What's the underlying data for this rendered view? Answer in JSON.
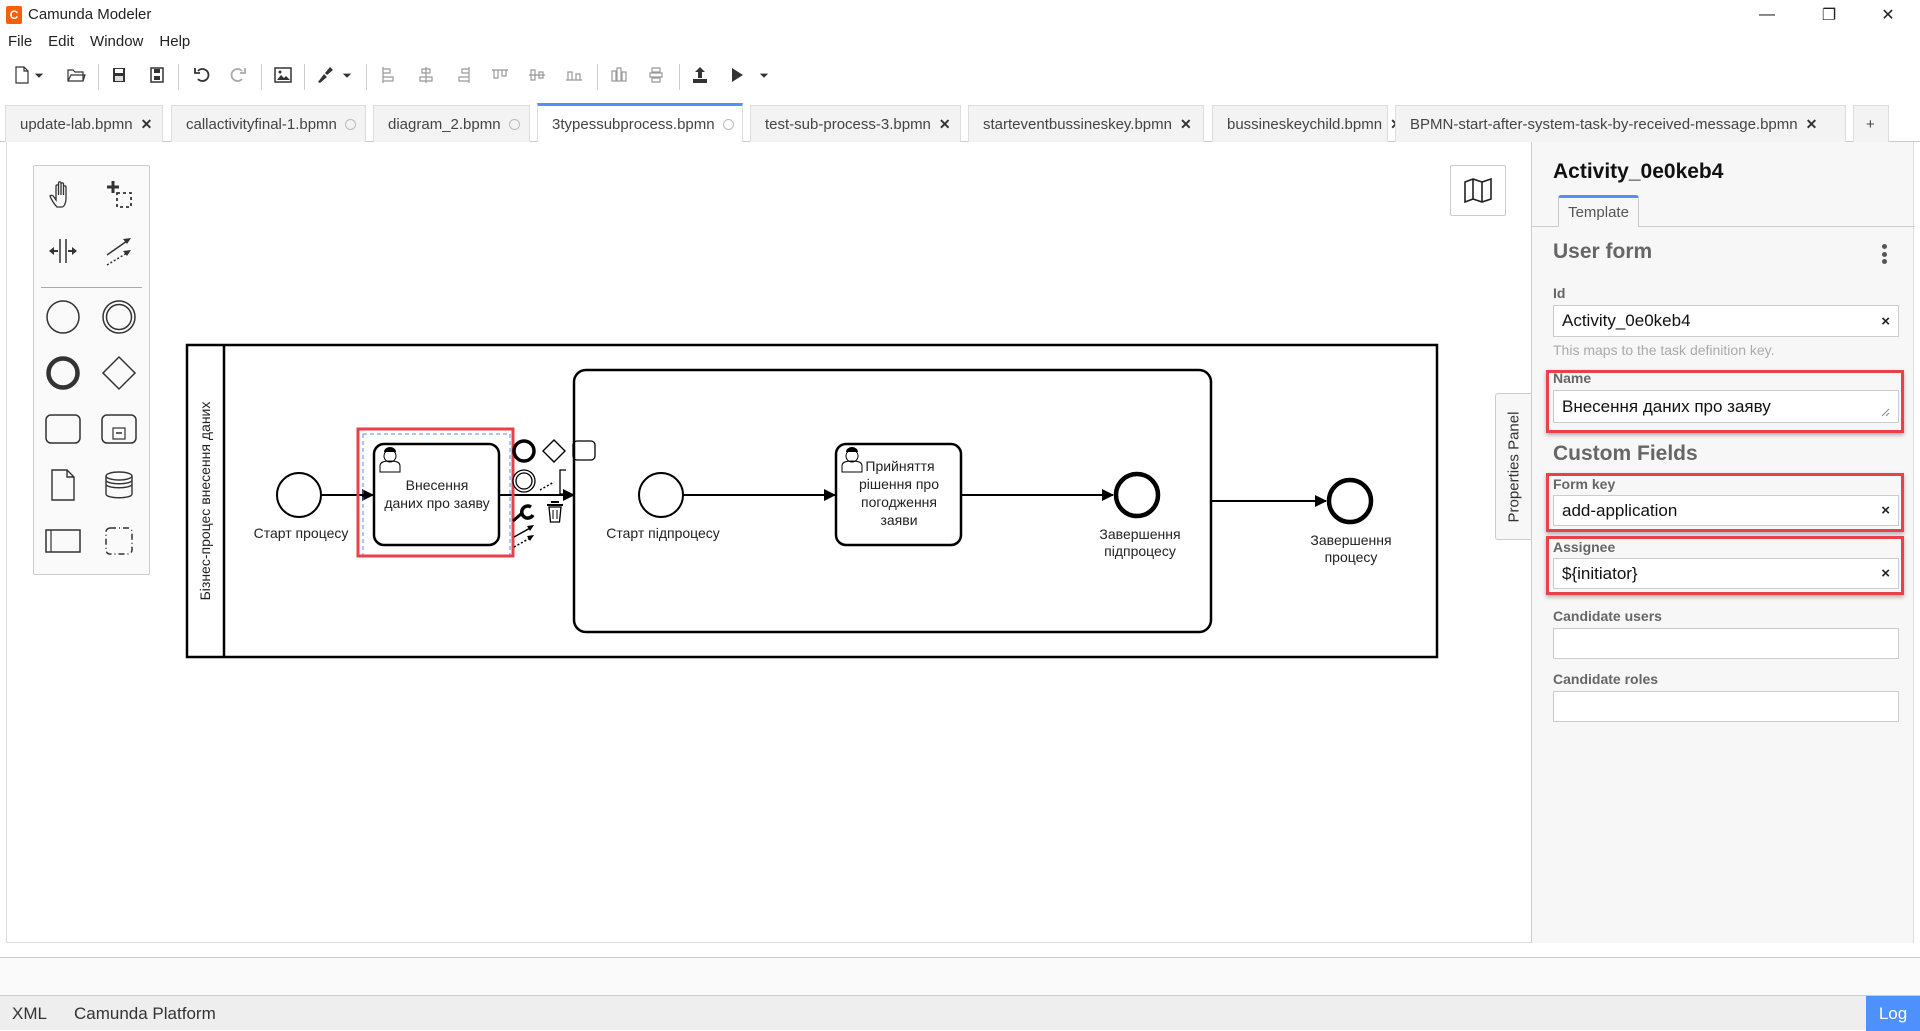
{
  "window": {
    "title": "Camunda Modeler",
    "logo_glyph": "C",
    "controls": {
      "minimize": "—",
      "maximize": "❐",
      "close": "✕"
    }
  },
  "menu": [
    "File",
    "Edit",
    "Window",
    "Help"
  ],
  "toolbar": {
    "icons": [
      "new-file-icon",
      "open-file-icon",
      "save-icon",
      "save-as-icon",
      "undo-icon",
      "redo-icon",
      "export-image-icon",
      "color-brush-icon",
      "align-left-icon",
      "align-center-icon",
      "align-right-icon",
      "align-top-icon",
      "align-middle-icon",
      "align-bottom-icon",
      "distribute-horizontal-icon",
      "distribute-vertical-icon",
      "deploy-icon",
      "run-icon"
    ]
  },
  "tabs": [
    {
      "label": "update-lab.bpmn",
      "state": "close"
    },
    {
      "label": "callactivityfinal-1.bpmn",
      "state": "unsaved"
    },
    {
      "label": "diagram_2.bpmn",
      "state": "unsaved"
    },
    {
      "label": "3typessubprocess.bpmn",
      "state": "unsaved",
      "active": true
    },
    {
      "label": "test-sub-process-3.bpmn",
      "state": "close"
    },
    {
      "label": "starteventbussineskey.bpmn",
      "state": "close"
    },
    {
      "label": "bussineskeychild.bpmn",
      "state": "close"
    },
    {
      "label": "BPMN-start-after-system-task-by-received-message.bpmn",
      "state": "close"
    }
  ],
  "new_tab_label": "+",
  "palette": {
    "tools": [
      "hand-tool",
      "lasso-tool",
      "space-tool",
      "global-connect-tool"
    ],
    "elements": [
      "start-event",
      "intermediate-event",
      "end-event",
      "gateway",
      "task",
      "subprocess",
      "data-object",
      "data-store",
      "pool",
      "group"
    ]
  },
  "diagram": {
    "pool_label": "Бізнес-процес внесення даних",
    "start_event_label": "Старт процесу",
    "task1_label": [
      "Внесення",
      "даних про заяву"
    ],
    "sub_start_label": "Старт підпроцесу",
    "task2_label": [
      "Прийняття",
      "рішення про",
      "погодження",
      "заяви"
    ],
    "sub_end_label": [
      "Завершення",
      "підпроцесу"
    ],
    "end_event_label": [
      "Завершення",
      "процесу"
    ]
  },
  "properties_panel": {
    "toggle_label": "Properties Panel",
    "element_id": "Activity_0e0keb4",
    "tab": "Template",
    "group": "User form",
    "id_label": "Id",
    "id_value": "Activity_0e0keb4",
    "id_hint": "This maps to the task definition key.",
    "name_label": "Name",
    "name_value": "Внесення даних про заяву",
    "custom_fields_title": "Custom Fields",
    "form_key_label": "Form key",
    "form_key_value": "add-application",
    "assignee_label": "Assignee",
    "assignee_value": "${initiator}",
    "candidate_users_label": "Candidate users",
    "candidate_users_value": "",
    "candidate_roles_label": "Candidate roles",
    "candidate_roles_value": "",
    "clear_glyph": "×",
    "highlight_color": "#e8414a"
  },
  "statusbar": {
    "xml": "XML",
    "platform": "Camunda Platform",
    "log": "Log"
  },
  "colors": {
    "accent": "#4d90fe",
    "highlight": "#e8414a",
    "selection": "#4d90fe"
  }
}
